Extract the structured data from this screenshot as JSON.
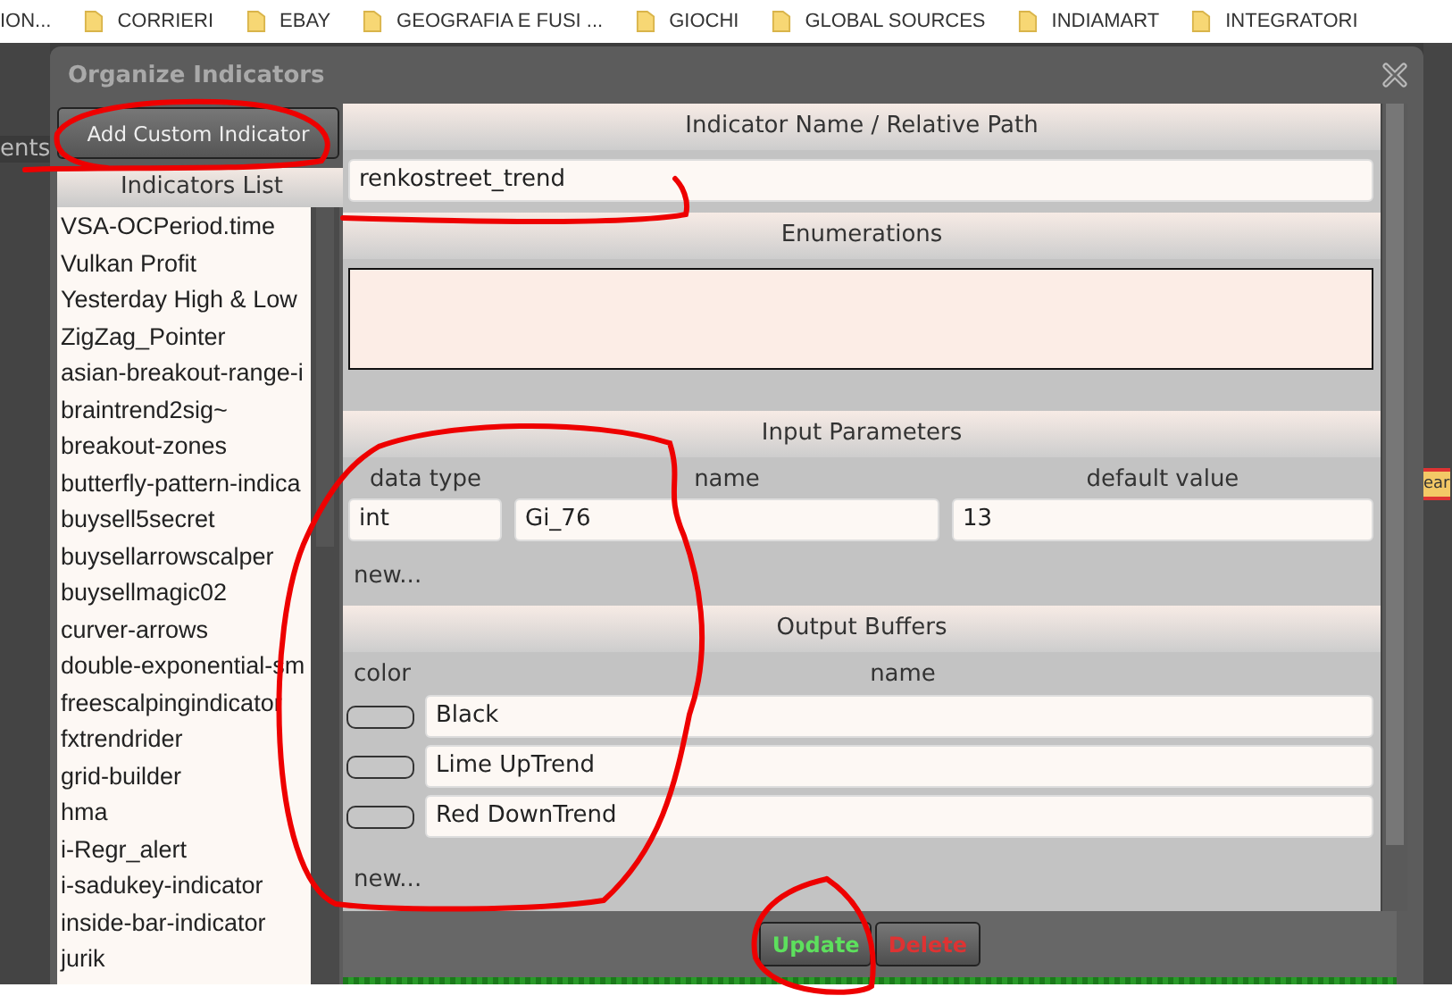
{
  "bookmarks": [
    "ION...",
    "CORRIERI",
    "EBAY",
    "GEOGRAFIA E FUSI ...",
    "GIOCHI",
    "GLOBAL SOURCES",
    "INDIAMART",
    "INTEGRATORI"
  ],
  "background": {
    "left_text": "ents",
    "right_tag": "ear"
  },
  "dialog": {
    "title": "Organize Indicators",
    "add_button": "Add Custom Indicator",
    "list_header": "Indicators List",
    "indicators": [
      "VSA-OCPeriod.time",
      "Vulkan Profit",
      "Yesterday High & Low",
      "ZigZag_Pointer",
      "asian-breakout-range-i",
      "braintrend2sig~",
      "breakout-zones",
      "butterfly-pattern-indica",
      "buysell5secret",
      "buysellarrowscalper",
      "buysellmagic02",
      "curver-arrows",
      "double-exponential-sm",
      "freescalpingindicator",
      "fxtrendrider",
      "grid-builder",
      "hma",
      "i-Regr_alert",
      "i-sadukey-indicator",
      "inside-bar-indicator",
      "jurik"
    ],
    "name_header": "Indicator Name / Relative Path",
    "name_value": "renkostreet_trend",
    "enum_header": "Enumerations",
    "input_header": "Input Parameters",
    "input_columns": [
      "data type",
      "name",
      "default value"
    ],
    "inputs": [
      {
        "type": "int",
        "name": "Gi_76",
        "default": "13"
      }
    ],
    "input_new": "new...",
    "output_header": "Output Buffers",
    "output_columns": [
      "color",
      "name"
    ],
    "outputs": [
      {
        "name": "Black"
      },
      {
        "name": "Lime UpTrend"
      },
      {
        "name": "Red DownTrend"
      }
    ],
    "output_new": "new...",
    "buttons": [
      {
        "label": "Update",
        "kind": "update"
      },
      {
        "label": "Delete",
        "kind": "delete"
      }
    ]
  }
}
